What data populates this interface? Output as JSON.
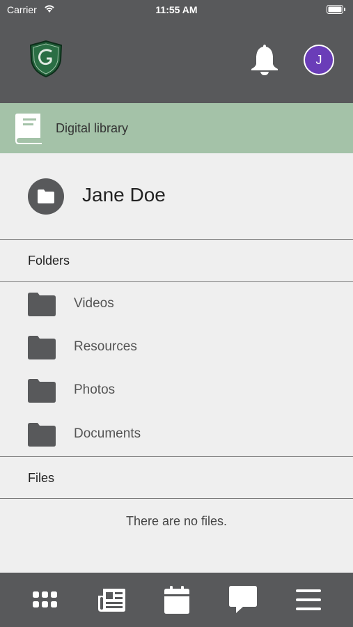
{
  "status_bar": {
    "carrier": "Carrier",
    "time": "11:55 AM"
  },
  "header": {
    "logo_icon": "school-crest-logo",
    "notification_icon": "bell-icon",
    "avatar_initial": "J",
    "avatar_color": "#6a3db8"
  },
  "section": {
    "title": "Digital library",
    "icon": "book-icon",
    "color": "#a4c2a8"
  },
  "owner": {
    "name": "Jane Doe",
    "icon": "folder-icon"
  },
  "folders": {
    "heading": "Folders",
    "items": [
      {
        "label": "Videos"
      },
      {
        "label": "Resources"
      },
      {
        "label": "Photos"
      },
      {
        "label": "Documents"
      }
    ]
  },
  "files": {
    "heading": "Files",
    "empty_text": "There are no files."
  },
  "tabs": [
    {
      "icon": "apps-grid-icon"
    },
    {
      "icon": "news-icon"
    },
    {
      "icon": "calendar-icon"
    },
    {
      "icon": "chat-icon"
    },
    {
      "icon": "menu-icon"
    }
  ],
  "colors": {
    "header_bg": "#58595b",
    "page_bg": "#efefef"
  }
}
